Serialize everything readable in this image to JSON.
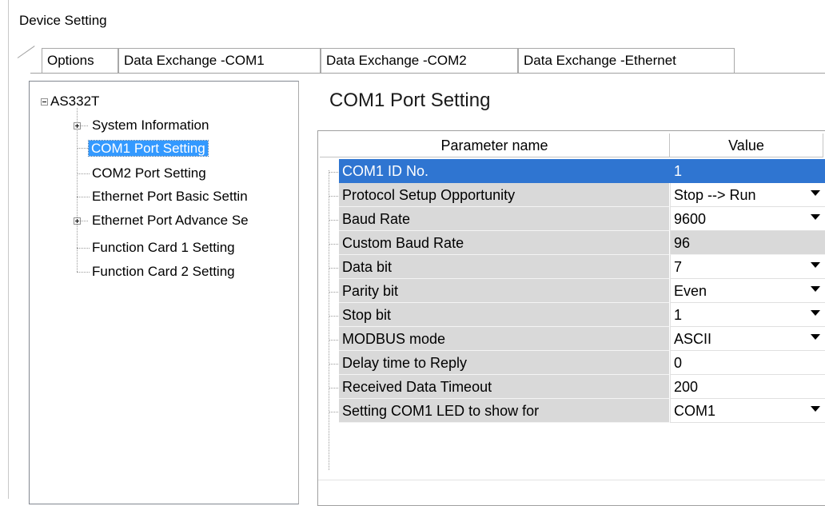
{
  "window": {
    "title": "Device Setting"
  },
  "tabs": [
    {
      "label": "Options",
      "selected": true
    },
    {
      "label": "Data Exchange -COM1",
      "selected": false
    },
    {
      "label": "Data Exchange -COM2",
      "selected": false
    },
    {
      "label": "Data Exchange -Ethernet",
      "selected": false
    }
  ],
  "tree": {
    "root": "AS332T",
    "items": [
      {
        "label": "System Information",
        "expandable": true
      },
      {
        "label": "COM1 Port Setting",
        "selected": true
      },
      {
        "label": "COM2 Port Setting"
      },
      {
        "label": "Ethernet Port Basic Settin"
      },
      {
        "label": "Ethernet Port Advance Se",
        "expandable": true
      },
      {
        "label": "Function Card 1 Setting"
      },
      {
        "label": "Function Card 2 Setting"
      }
    ]
  },
  "section": {
    "title": "COM1 Port Setting"
  },
  "grid": {
    "headers": {
      "name": "Parameter name",
      "value": "Value"
    },
    "rows": [
      {
        "name": "COM1 ID No.",
        "value": "1",
        "dropdown": false,
        "selected": true
      },
      {
        "name": "Protocol Setup Opportunity",
        "value": "Stop --> Run",
        "dropdown": true
      },
      {
        "name": "Baud Rate",
        "value": "9600",
        "dropdown": true
      },
      {
        "name": "Custom Baud Rate",
        "value": "96",
        "dropdown": false,
        "readonly": true
      },
      {
        "name": "Data bit",
        "value": "7",
        "dropdown": true
      },
      {
        "name": "Parity bit",
        "value": "Even",
        "dropdown": true
      },
      {
        "name": "Stop bit",
        "value": "1",
        "dropdown": true
      },
      {
        "name": "MODBUS mode",
        "value": "ASCII",
        "dropdown": true
      },
      {
        "name": "Delay time to Reply",
        "value": "0",
        "dropdown": false
      },
      {
        "name": "Received Data Timeout",
        "value": "200",
        "dropdown": false
      },
      {
        "name": "Setting COM1 LED to show for",
        "value": "COM1",
        "dropdown": true
      }
    ]
  },
  "colors": {
    "selection_blue": "#2f75d1",
    "tree_selection": "#3399ff",
    "param_gray": "#d9d9d9"
  }
}
